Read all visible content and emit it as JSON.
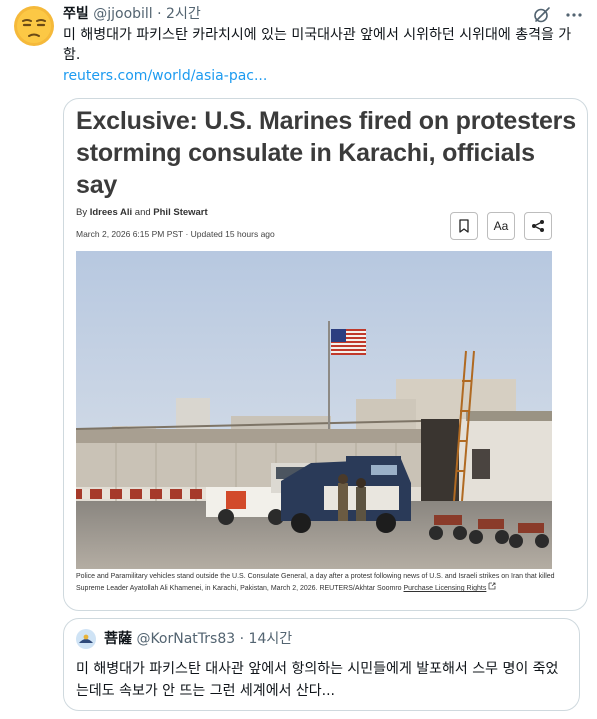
{
  "post": {
    "display_name": "쭈빌",
    "handle": "@jjoobill",
    "separator": "·",
    "time": "2시간",
    "text": "미 해병대가 파키스탄 카라치시에 있는 미국대사관 앞에서 시위하던 시위대에 총격을 가함.",
    "link": "reuters.com/world/asia-pac..."
  },
  "header_icons": [
    "grok-icon",
    "more-icon"
  ],
  "card": {
    "headline": "Exclusive: U.S. Marines fired on protesters storming consulate in Karachi, officials say",
    "byline_prefix": "By",
    "author_1": "Idrees Ali",
    "byline_and": "and",
    "author_2": "Phil Stewart",
    "dateline": "March 2, 2026 6:15 PM PST · Updated 15 hours ago",
    "text_size_label": "Aa",
    "caption": "Police and Paramilitary vehicles stand outside the U.S. Consulate General, a day after a protest following news of U.S. and Israeli strikes on Iran that killed Supreme Leader Ayatollah Ali Khamenei, in Karachi, Pakistan, March 2, 2026. REUTERS/Akhtar Soomro",
    "license_label": "Purchase Licensing Rights"
  },
  "quote": {
    "display_name": "菩薩",
    "handle": "@KorNatTrs83",
    "separator": "·",
    "time": "14시간",
    "text": "미 해병대가 파키스탄 대사관 앞에서 항의하는 시민들에게 발포해서 스무 명이 죽었는데도 속보가 안 뜨는 그런 세계에서 산다..."
  },
  "colors": {
    "link": "#1d9bf0",
    "secondary_text": "#536471",
    "border": "#cfd9de",
    "headline": "#3b3b3b"
  }
}
